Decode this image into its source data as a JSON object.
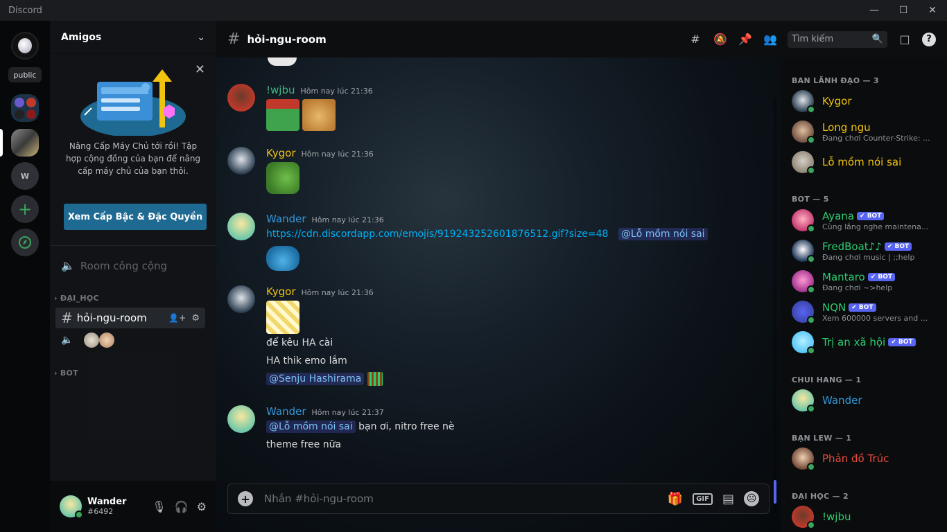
{
  "window": {
    "title": "Discord"
  },
  "servers": {
    "public_label": "public",
    "w_label": "W"
  },
  "guild": {
    "name": "Amigos",
    "boost_text": "Nâng Cấp Máy Chủ tới rồi! Tập hợp cộng đồng của bạn để nâng cấp máy chủ của bạn thôi.",
    "boost_button": "Xem Cấp Bậc & Đặc Quyền",
    "voice_public": "Room công cộng",
    "category_1": "ĐẠI_HỌC",
    "active_channel": "hỏi-ngu-room",
    "category_2": "BOT"
  },
  "user": {
    "name": "Wander",
    "tag": "#6492"
  },
  "header": {
    "channel": "hỏi-ngu-room",
    "search_placeholder": "Tìm kiếm"
  },
  "messages": [
    {
      "author": "!wjbu",
      "time": "Hôm nay lúc 21:36",
      "color": "#43b581"
    },
    {
      "author": "Kygor",
      "time": "Hôm nay lúc 21:36",
      "color": "#f1c40f"
    },
    {
      "author": "Wander",
      "time": "Hôm nay lúc 21:36",
      "color": "#3498db",
      "link": "https://cdn.discordapp.com/emojis/919243252601876512.gif?size=48",
      "mention": "@Lỗ mồm nói sai"
    },
    {
      "author": "Kygor",
      "time": "Hôm nay lúc 21:36",
      "color": "#f1c40f",
      "line1": "để kêu HA cài",
      "line2": "HA thik emo lắm",
      "mention": "@Senju Hashirama"
    },
    {
      "author": "Wander",
      "time": "Hôm nay lúc 21:37",
      "color": "#3498db",
      "mention": "@Lỗ mồm nói sai",
      "text_after": "bạn ơi, nitro free nè",
      "line2": "theme free nữa"
    }
  ],
  "composer": {
    "placeholder": "Nhắn #hỏi-ngu-room",
    "gif_label": "GIF"
  },
  "members": {
    "groups": [
      {
        "title": "BAN LÃNH ĐẠO — 3"
      },
      {
        "title": "BOT — 5"
      },
      {
        "title": "CHUI HANG — 1"
      },
      {
        "title": "BẠN LEW — 1"
      },
      {
        "title": "ĐẠI HỌC — 2"
      }
    ],
    "leaders": [
      {
        "name": "Kygor",
        "color": "#f1c40f"
      },
      {
        "name": "Long ngu",
        "sub": "Đang chơi Counter-Strike: ...",
        "color": "#f1c40f"
      },
      {
        "name": "Lỗ mồm nói sai",
        "color": "#f1c40f"
      }
    ],
    "bots": [
      {
        "name": "Ayana",
        "sub": "Cùng lắng nghe maintena...",
        "color": "#2ecc71"
      },
      {
        "name": "FredBoat♪♪",
        "sub": "Đang chơi music | ;;help",
        "color": "#2ecc71"
      },
      {
        "name": "Mantaro",
        "sub": "Đang chơi ~>help",
        "color": "#2ecc71"
      },
      {
        "name": "NQN",
        "sub": "Xem 600000 servers and ...",
        "color": "#2ecc71"
      },
      {
        "name": "Trị an xã hội",
        "color": "#2ecc71"
      }
    ],
    "bot_badge": "✔ BOT",
    "chui_hang": [
      {
        "name": "Wander",
        "color": "#3498db"
      }
    ],
    "ban_lew": [
      {
        "name": "Phản đồ Trúc",
        "color": "#e74c3c"
      }
    ],
    "dai_hoc": [
      {
        "name": "!wjbu",
        "color": "#2ecc71"
      }
    ]
  }
}
